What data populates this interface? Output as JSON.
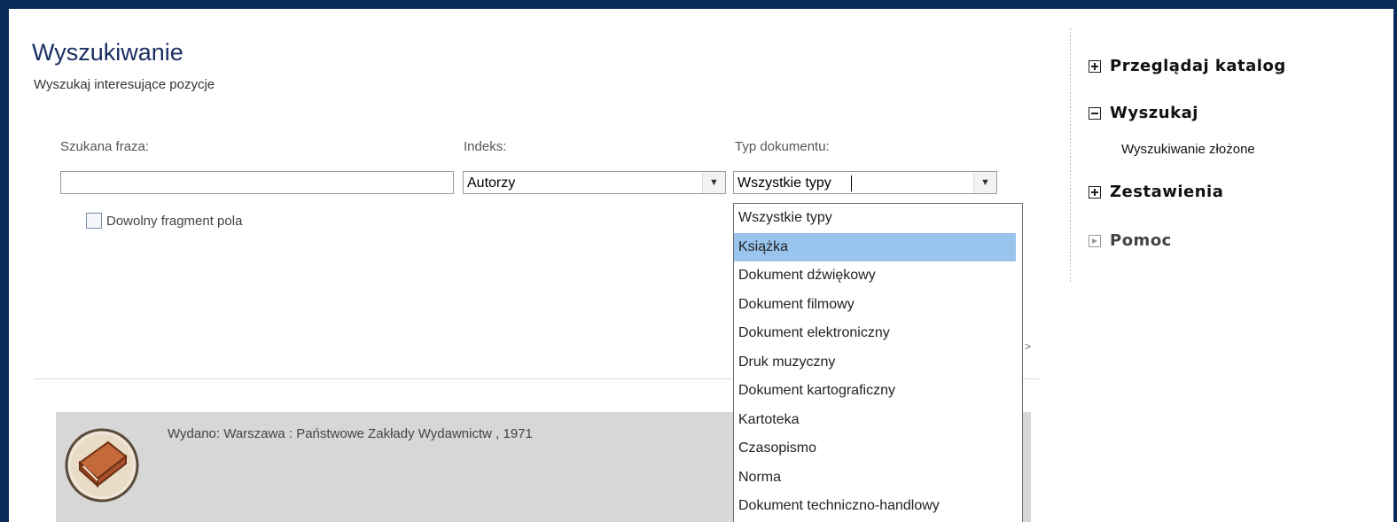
{
  "page": {
    "title": "Wyszukiwanie",
    "subtitle": "Wyszukaj interesujące pozycje"
  },
  "search_form": {
    "phrase_label": "Szukana fraza:",
    "phrase_value": "",
    "index_label": "Indeks:",
    "index_value": "Autorzy",
    "doctype_label": "Typ dokumentu:",
    "doctype_value": "Wszystkie typy",
    "any_fragment_label": "Dowolny fragment pola",
    "any_fragment_checked": false
  },
  "doctype_dropdown": {
    "options": [
      "Wszystkie typy",
      "Książka",
      "Dokument dźwiękowy",
      "Dokument filmowy",
      "Dokument elektroniczny",
      "Druk muzyczny",
      "Dokument kartograficzny",
      "Kartoteka",
      "Czasopismo",
      "Norma",
      "Dokument techniczno-handlowy"
    ],
    "highlighted": "Książka",
    "highlight_color": "#99c4ed"
  },
  "result": {
    "published": "Wydano: Warszawa : Państwowe Zakłady Wydawnictw , 1971",
    "icon": "book-icon"
  },
  "stray_glyph": ">",
  "sidebar": {
    "items": [
      {
        "label": "Przeglądaj katalog",
        "icon": "expand-plus-icon"
      },
      {
        "label": "Wyszukaj",
        "icon": "collapse-minus-icon"
      },
      {
        "label": "Wyszukiwanie złożone"
      },
      {
        "label": "Zestawienia",
        "icon": "expand-plus-icon"
      },
      {
        "label": "Pomoc",
        "icon": "arrow-box-icon"
      }
    ]
  },
  "colors": {
    "frame": "#0b2a5c",
    "title": "#1b2f63",
    "result_background": "#d7d7d7"
  }
}
